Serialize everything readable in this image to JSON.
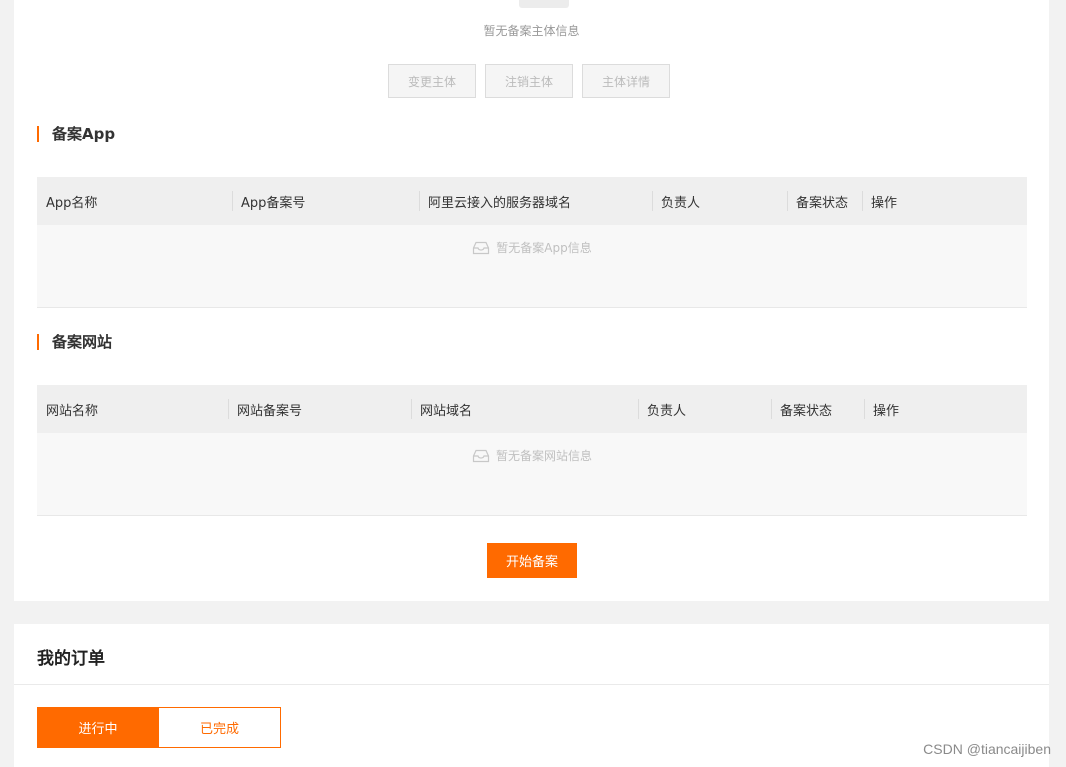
{
  "subject": {
    "empty_text": "暂无备案主体信息",
    "buttons": {
      "change": "变更主体",
      "cancel": "注销主体",
      "details": "主体详情"
    }
  },
  "app_section": {
    "title": "备案App",
    "columns": [
      "App名称",
      "App备案号",
      "阿里云接入的服务器域名",
      "负责人",
      "备案状态",
      "操作"
    ],
    "empty_text": "暂无备案App信息"
  },
  "website_section": {
    "title": "备案网站",
    "columns": [
      "网站名称",
      "网站备案号",
      "网站域名",
      "负责人",
      "备案状态",
      "操作"
    ],
    "empty_text": "暂无备案网站信息"
  },
  "start_button": "开始备案",
  "orders": {
    "title": "我的订单",
    "tabs": [
      "进行中",
      "已完成"
    ]
  },
  "watermark": "CSDN @tiancaijiben",
  "colors": {
    "accent": "#ff6a00"
  },
  "icons": {
    "empty": "inbox-icon",
    "subject_empty": "box-icon"
  }
}
